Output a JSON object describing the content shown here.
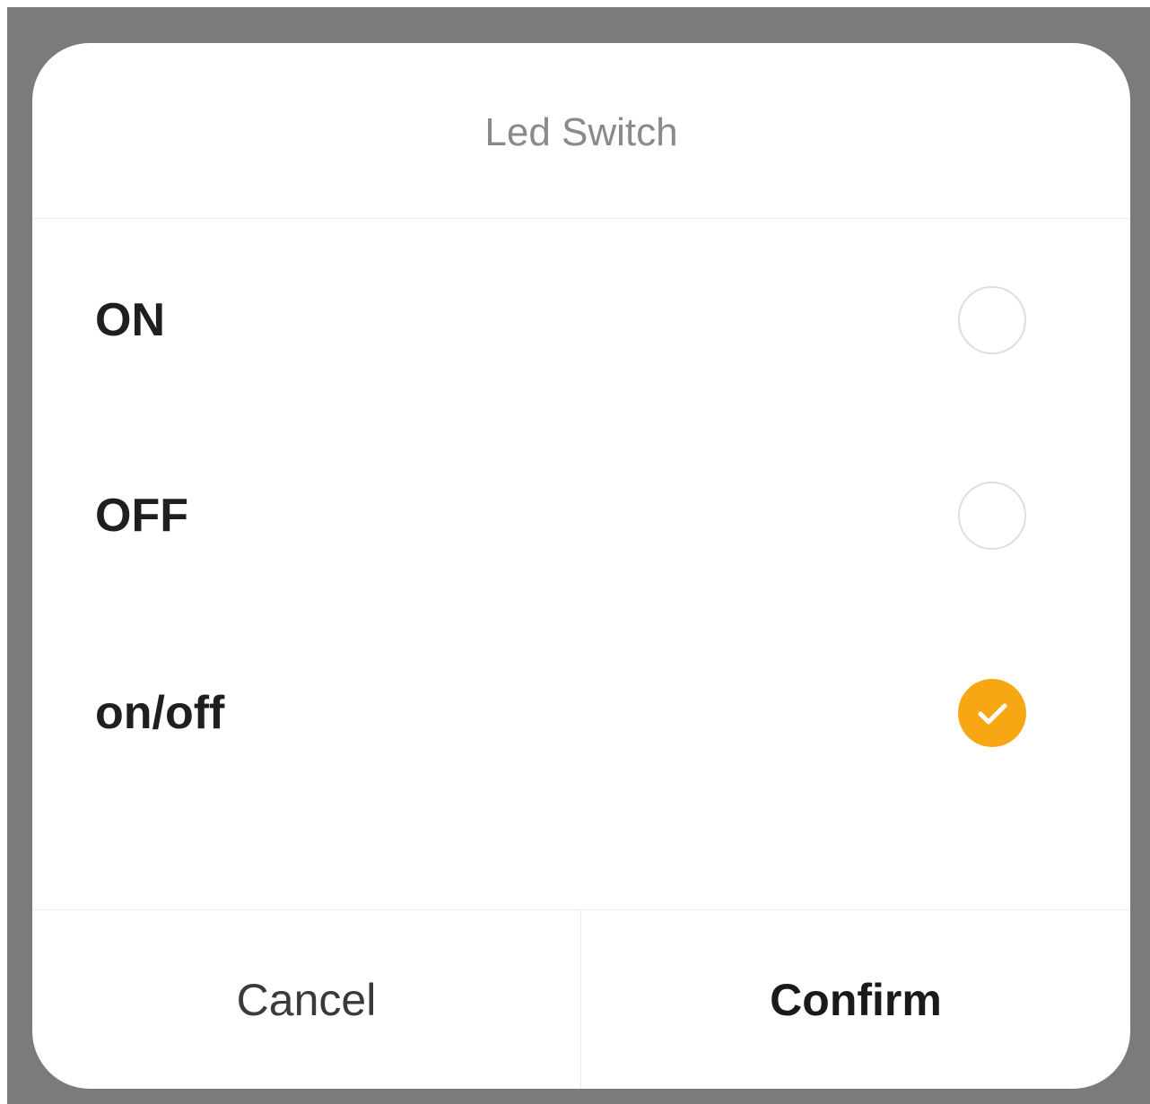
{
  "dialog": {
    "title": "Led Switch",
    "options": [
      {
        "label": "ON",
        "selected": false
      },
      {
        "label": "OFF",
        "selected": false
      },
      {
        "label": "on/off",
        "selected": true
      }
    ],
    "cancel_label": "Cancel",
    "confirm_label": "Confirm"
  },
  "colors": {
    "accent": "#f7a713",
    "backdrop": "#7b7b7b"
  },
  "icons": {
    "selected": "check-icon"
  }
}
